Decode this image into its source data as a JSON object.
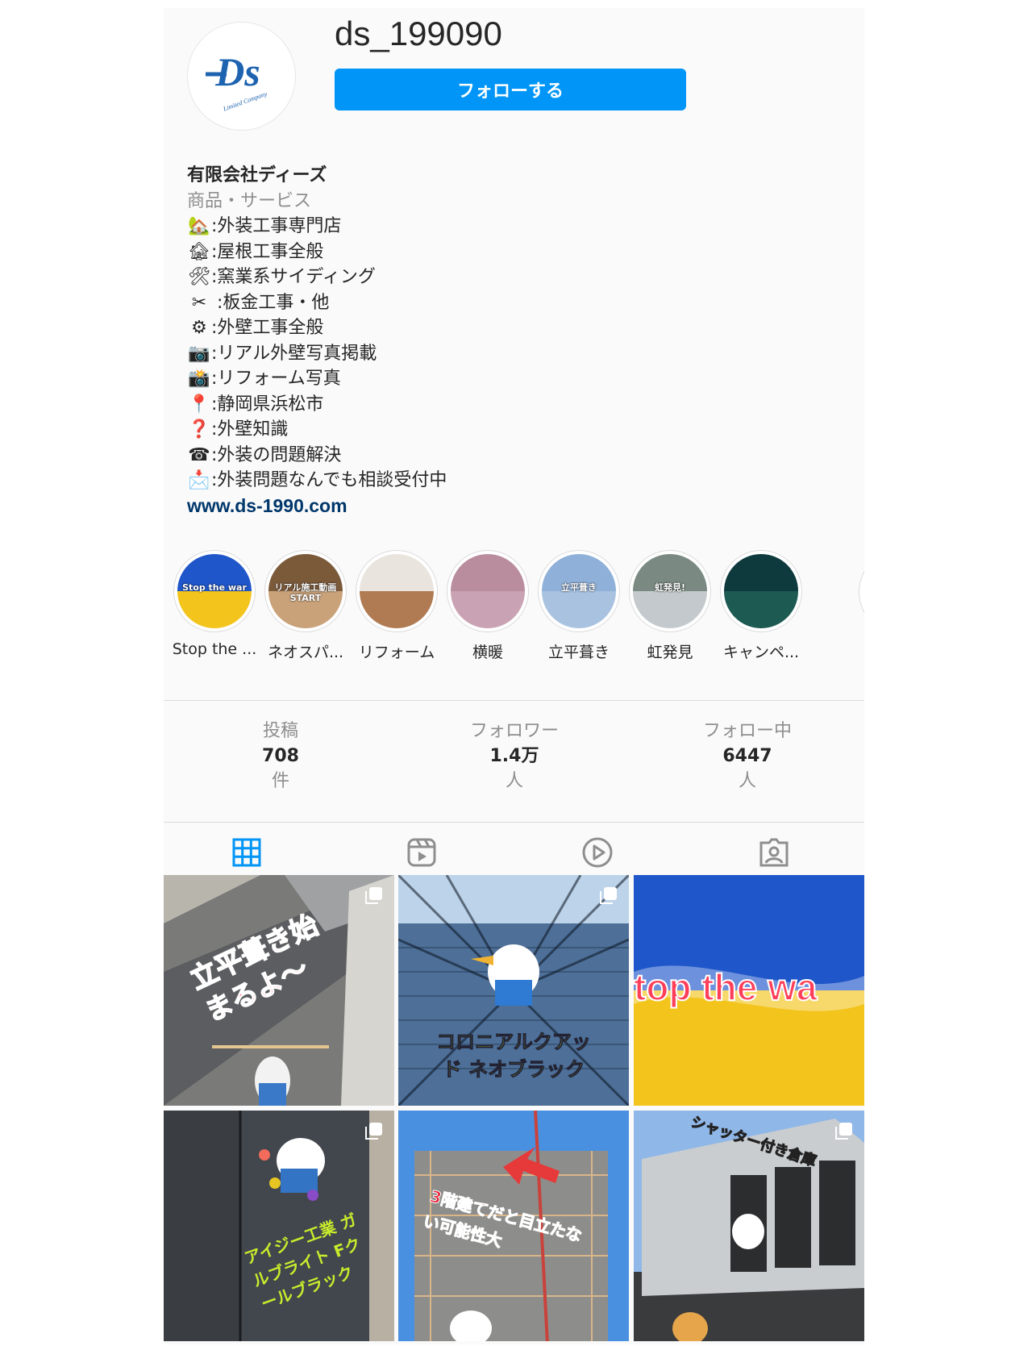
{
  "profile": {
    "username": "ds_199090",
    "follow_label": "フォローする",
    "avatar_logo_text": "Ds",
    "avatar_logo_sub": "Limited Company"
  },
  "bio": {
    "name": "有限会社ディーズ",
    "category": "商品・サービス",
    "lines": [
      {
        "icon": "🏡",
        "text": ":外装工事専門店"
      },
      {
        "icon": "🏚",
        "text": ":屋根工事全般"
      },
      {
        "icon": "🛠",
        "text": ":窯業系サイディング"
      },
      {
        "icon": "✂",
        "text": " :板金工事・他"
      },
      {
        "icon": "⚙",
        "text": ":外壁工事全般"
      },
      {
        "icon": "📷",
        "text": ":リアル外壁写真掲載"
      },
      {
        "icon": "📸",
        "text": ":リフォーム写真"
      },
      {
        "icon": "📍",
        "text": ":静岡県浜松市"
      },
      {
        "icon": "❓",
        "text": ":外壁知識"
      },
      {
        "icon": "☎",
        "text": ":外装の問題解決"
      },
      {
        "icon": "📩",
        "text": ":外装問題なんでも相談受付中"
      }
    ],
    "website": "www.ds-1990.com"
  },
  "highlights": [
    {
      "label": "Stop the ...",
      "thumb_text": "Stop the war"
    },
    {
      "label": "ネオスパ...",
      "thumb_text": "リアル施工動画 START"
    },
    {
      "label": "リフォーム",
      "thumb_text": ""
    },
    {
      "label": "横暖",
      "thumb_text": ""
    },
    {
      "label": "立平葺き",
      "thumb_text": "立平葺き"
    },
    {
      "label": "虹発見",
      "thumb_text": "虹発見!"
    },
    {
      "label": "キャンペ...",
      "thumb_text": ""
    }
  ],
  "stats": [
    {
      "label": "投稿",
      "value": "708",
      "unit": "件"
    },
    {
      "label": "フォロワー",
      "value": "1.4万",
      "unit": "人"
    },
    {
      "label": "フォロー中",
      "value": "6447",
      "unit": "人"
    }
  ],
  "tabs": [
    "posts-grid",
    "reels",
    "video",
    "tagged"
  ],
  "posts": [
    {
      "text": "立平葺き始まるよ〜"
    },
    {
      "text": "コロニアルクアッド ネオブラック"
    },
    {
      "text": "top the wa"
    },
    {
      "text": "アイジー工業 ガルブライト Fクールブラック"
    },
    {
      "text": "3階建てだと目立たない可能性大"
    },
    {
      "text": "シャッター付き倉庫"
    }
  ],
  "colors": {
    "accent": "#0095f6",
    "link": "#00376b",
    "background": "#fafafa"
  }
}
